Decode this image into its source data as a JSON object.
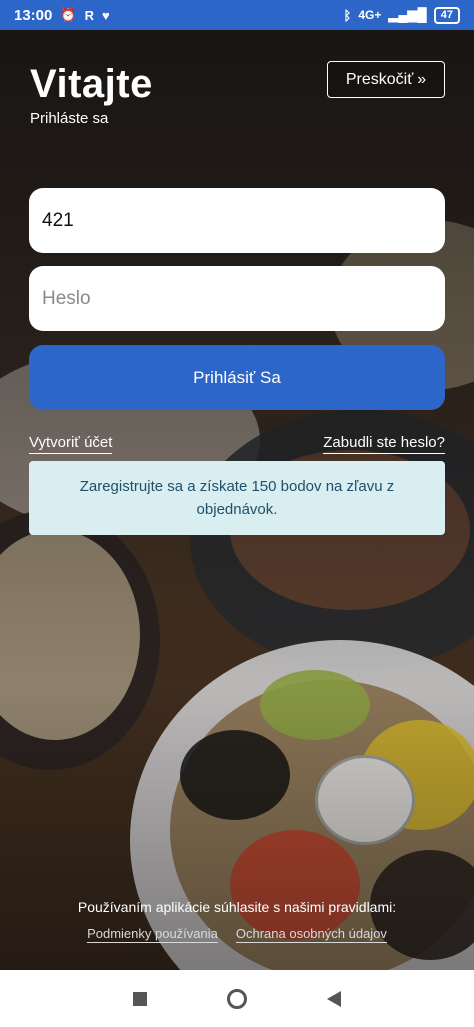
{
  "status_bar": {
    "time": "13:00",
    "left_icons": [
      "alarm-icon",
      "r-app-icon",
      "heart-app-icon"
    ],
    "right_icons": [
      "bluetooth-icon",
      "signal-4g-icon",
      "signal-bars-icon"
    ],
    "battery": "47"
  },
  "header": {
    "title": "Vitajte",
    "subtitle": "Prihláste sa",
    "skip_label": "Preskočiť",
    "skip_icon": "double-chevron-right-icon"
  },
  "form": {
    "phone_value": "421",
    "password_placeholder": "Heslo",
    "login_label": "Prihlásiť Sa"
  },
  "links": {
    "create_account": "Vytvoriť účet",
    "forgot_password": "Zabudli ste heslo?"
  },
  "promo": {
    "text": "Zaregistrujte sa a získate 150 bodov na zľavu z objednávok."
  },
  "terms": {
    "text": "Používaním aplikácie súhlasite s našimi pravidlami:",
    "terms_link": "Podmienky používania",
    "privacy_link": "Ochrana osobných údajov"
  },
  "colors": {
    "accent": "#2d66c9",
    "promo_bg": "#d8eef0",
    "promo_text": "#21506a"
  }
}
